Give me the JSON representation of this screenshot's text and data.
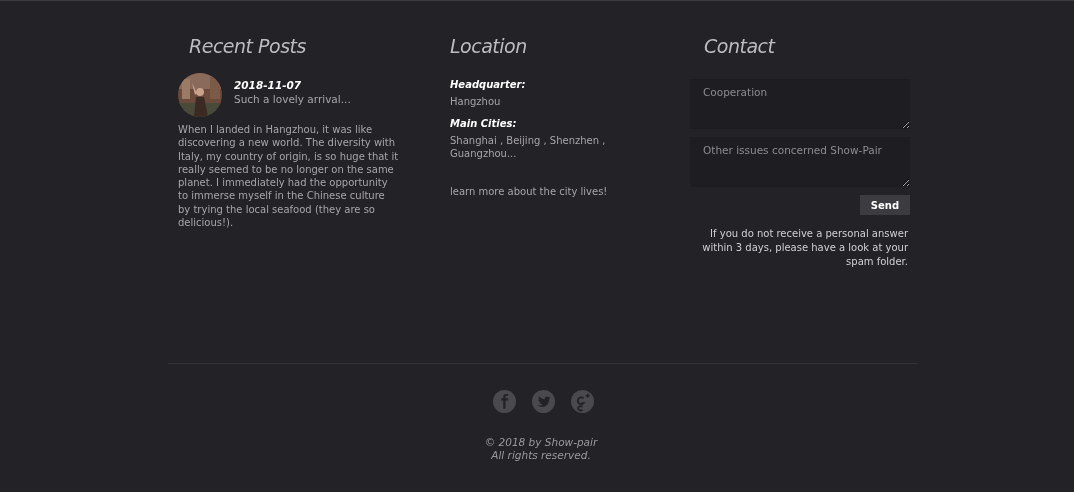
{
  "recent_posts": {
    "title": "Recent Posts",
    "post": {
      "date": "2018-11-07",
      "headline": "Such a lovely arrival...",
      "body": "When I landed in Hangzhou, it was like discovering a new world. The diversity with Italy, my country of origin, is so huge that it really seemed to be no longer on the same planet. I immediately had the opportunity to immerse myself in the Chinese culture by trying the local seafood (they are so delicious!)."
    }
  },
  "location": {
    "title": "Location",
    "sections": [
      {
        "label": "Headquarter:",
        "value": "Hangzhou"
      },
      {
        "label": "Main Cities:",
        "value": "Shanghai , Beijing , Shenzhen , Guangzhou..."
      }
    ],
    "link": "learn more about the city lives!"
  },
  "contact": {
    "title": "Contact",
    "fields": [
      {
        "placeholder": "Cooperation"
      },
      {
        "placeholder": "Other issues concerned Show-Pair"
      }
    ],
    "button": "Send",
    "note": "If you do not receive a personal answer within 3 days, please have a look at your spam folder."
  },
  "footer": {
    "socials": [
      {
        "kind": "facebook"
      },
      {
        "kind": "twitter"
      },
      {
        "kind": "googleplus"
      }
    ],
    "copyright": "© 2018 by Show-pair",
    "rights": "All rights reserved."
  }
}
